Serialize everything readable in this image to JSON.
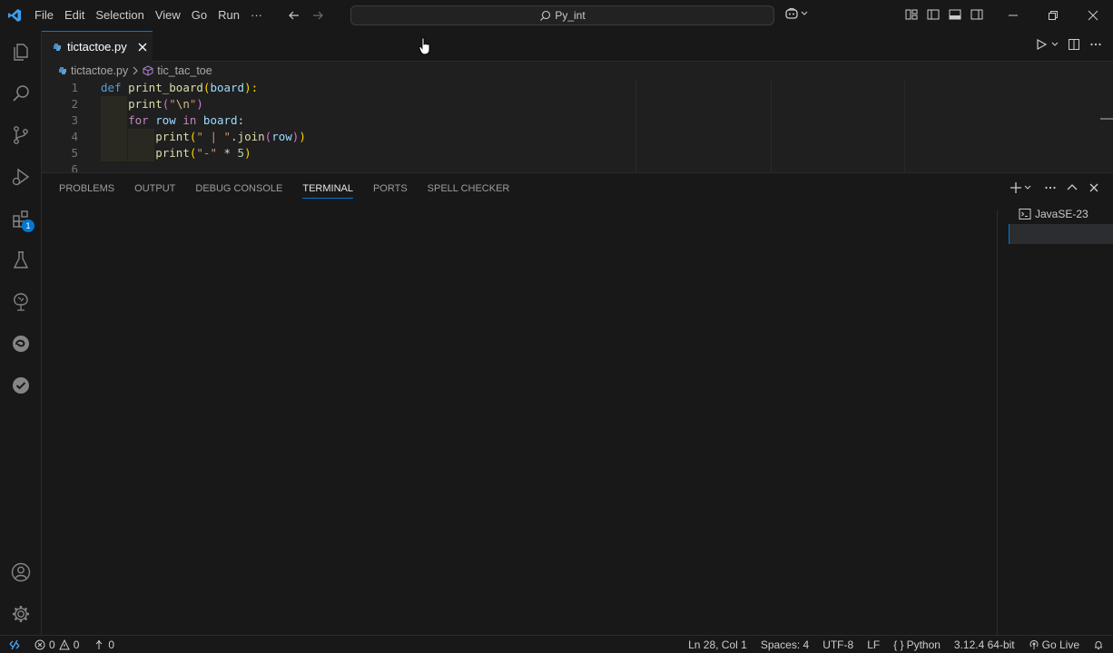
{
  "titlebar": {
    "menu": [
      "File",
      "Edit",
      "Selection",
      "View",
      "Go",
      "Run",
      "···"
    ],
    "search_text": "Py_int"
  },
  "activity": {
    "extensions_badge": "1"
  },
  "tab": {
    "filename": "tictactoe.py"
  },
  "breadcrumb": {
    "file": "tictactoe.py",
    "symbol": "tic_tac_toe"
  },
  "editor": {
    "lines": [
      {
        "n": "1"
      },
      {
        "n": "2"
      },
      {
        "n": "3"
      },
      {
        "n": "4"
      },
      {
        "n": "5"
      },
      {
        "n": "6"
      }
    ],
    "code": {
      "l1_kw": "def",
      "l1_fn": "print_board",
      "l1_p1": "(",
      "l1_var": "board",
      "l1_p2": "):",
      "l2_fn": "print",
      "l2_p1": "(",
      "l2_s1": "\"",
      "l2_esc": "\\n",
      "l2_s2": "\"",
      "l2_p2": ")",
      "l3_kw": "for",
      "l3_var1": "row",
      "l3_in": "in",
      "l3_var2": "board",
      "l3_colon": ":",
      "l4_fn": "print",
      "l4_p1": "(",
      "l4_str": "\" | \"",
      "l4_dot": ".",
      "l4_join": "join",
      "l4_p2": "(",
      "l4_var": "row",
      "l4_p3": ")",
      "l4_p4": ")",
      "l5_fn": "print",
      "l5_p1": "(",
      "l5_str": "\"-\"",
      "l5_op": " * ",
      "l5_num": "5",
      "l5_p2": ")"
    }
  },
  "panel": {
    "tabs": [
      "PROBLEMS",
      "OUTPUT",
      "DEBUG CONSOLE",
      "TERMINAL",
      "PORTS",
      "SPELL CHECKER"
    ],
    "active_tab": "TERMINAL",
    "terminals": [
      "JavaSE-23"
    ]
  },
  "statusbar": {
    "errors": "0",
    "warnings": "0",
    "ports": "0",
    "position": "Ln 28, Col 1",
    "spaces": "Spaces: 4",
    "encoding": "UTF-8",
    "eol": "LF",
    "language": "Python",
    "interpreter": "3.12.4 64-bit",
    "golive": "Go Live"
  },
  "colors": {
    "accent": "#0078d4",
    "background": "#181818",
    "editor_bg": "#1f1f1f"
  }
}
